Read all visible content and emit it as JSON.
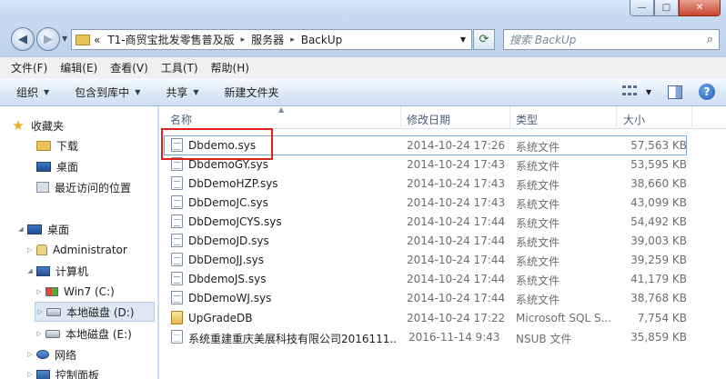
{
  "window": {
    "controls": {
      "minimize": "—",
      "maximize": "□",
      "close": "✕"
    }
  },
  "address": {
    "overflow": "«",
    "crumbs": [
      "T1-商贸宝批发零售普及版",
      "服务器",
      "BackUp"
    ],
    "separator": "▸"
  },
  "search": {
    "placeholder": "搜索 BackUp"
  },
  "menu": [
    "文件(F)",
    "编辑(E)",
    "查看(V)",
    "工具(T)",
    "帮助(H)"
  ],
  "toolbar": {
    "organize": "组织",
    "include_library": "包含到库中",
    "share": "共享",
    "new_folder": "新建文件夹"
  },
  "nav": {
    "favorites": "收藏夹",
    "downloads": "下载",
    "desktop_fav": "桌面",
    "recent": "最近访问的位置",
    "desktop": "桌面",
    "user": "Administrator",
    "computer": "计算机",
    "drive_c": "Win7 (C:)",
    "drive_d": "本地磁盘 (D:)",
    "drive_e": "本地磁盘 (E:)",
    "network": "网络",
    "control_panel": "控制面板"
  },
  "columns": {
    "name": "名称",
    "date": "修改日期",
    "type": "类型",
    "size": "大小"
  },
  "files": [
    {
      "name": "Dbdemo.sys",
      "date": "2014-10-24 17:26",
      "type": "系统文件",
      "size": "57,563 KB",
      "icon": "sys-file-icon"
    },
    {
      "name": "DbdemoGY.sys",
      "date": "2014-10-24 17:43",
      "type": "系统文件",
      "size": "53,595 KB",
      "icon": "sys-file-icon"
    },
    {
      "name": "DbDemoHZP.sys",
      "date": "2014-10-24 17:43",
      "type": "系统文件",
      "size": "38,660 KB",
      "icon": "sys-file-icon"
    },
    {
      "name": "DbDemoJC.sys",
      "date": "2014-10-24 17:43",
      "type": "系统文件",
      "size": "43,099 KB",
      "icon": "sys-file-icon"
    },
    {
      "name": "DbDemoJCYS.sys",
      "date": "2014-10-24 17:44",
      "type": "系统文件",
      "size": "54,492 KB",
      "icon": "sys-file-icon"
    },
    {
      "name": "DbDemoJD.sys",
      "date": "2014-10-24 17:44",
      "type": "系统文件",
      "size": "39,003 KB",
      "icon": "sys-file-icon"
    },
    {
      "name": "DbDemoJJ.sys",
      "date": "2014-10-24 17:44",
      "type": "系统文件",
      "size": "39,259 KB",
      "icon": "sys-file-icon"
    },
    {
      "name": "DbdemoJS.sys",
      "date": "2014-10-24 17:44",
      "type": "系统文件",
      "size": "41,179 KB",
      "icon": "sys-file-icon"
    },
    {
      "name": "DbDemoWJ.sys",
      "date": "2014-10-24 17:44",
      "type": "系统文件",
      "size": "38,768 KB",
      "icon": "sys-file-icon"
    },
    {
      "name": "UpGradeDB",
      "date": "2014-10-24 17:22",
      "type": "Microsoft SQL S...",
      "size": "7,754 KB",
      "icon": "sql-db-icon"
    },
    {
      "name": "系统重建重庆美展科技有限公司2016111...",
      "date": "2016-11-14 9:43",
      "type": "NSUB 文件",
      "size": "35,859 KB",
      "icon": "nsub-file-icon"
    }
  ],
  "highlight_color": "#e0211b"
}
